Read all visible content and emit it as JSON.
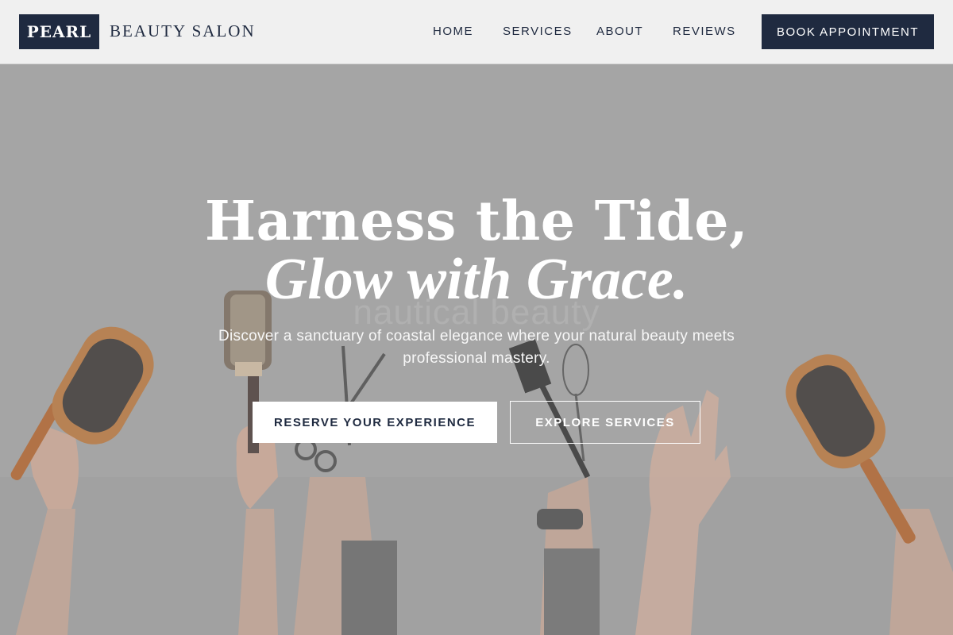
{
  "brand": {
    "logo_text": "PEARL",
    "subtitle": "BEAUTY SALON"
  },
  "nav": {
    "items": [
      {
        "label": "HOME"
      },
      {
        "label": "SERVICES"
      },
      {
        "label": "ABOUT"
      },
      {
        "label": "REVIEWS"
      }
    ],
    "cta_label": "BOOK APPOINTMENT"
  },
  "hero": {
    "title_line1": "Harness the Tide,",
    "title_line2": "Glow with Grace.",
    "watermark": "nautical beauty",
    "description": "Discover a sanctuary of coastal elegance where your natural beauty meets professional mastery.",
    "primary_button": "RESERVE YOUR EXPERIENCE",
    "secondary_button": "EXPLORE SERVICES"
  },
  "colors": {
    "navy": "#1f2a40",
    "header_bg": "#f0f0f0",
    "hero_bg": "#a9a9a9"
  }
}
